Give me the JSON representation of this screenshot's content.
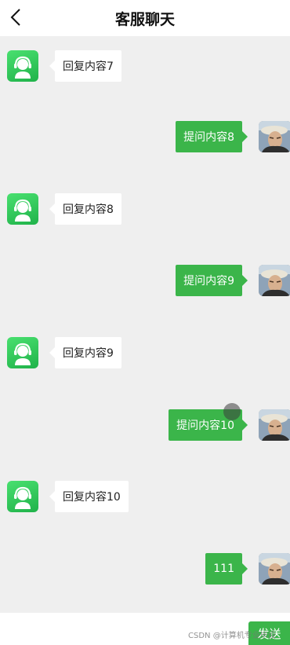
{
  "header": {
    "title": "客服聊天",
    "back_icon": "chevron-left-icon"
  },
  "messages": [
    {
      "role": "service",
      "text": "回复内容7"
    },
    {
      "role": "user",
      "text": "提问内容8"
    },
    {
      "role": "service",
      "text": "回复内容8"
    },
    {
      "role": "user",
      "text": "提问内容9"
    },
    {
      "role": "service",
      "text": "回复内容9"
    },
    {
      "role": "user",
      "text": "提问内容10"
    },
    {
      "role": "service",
      "text": "回复内容10"
    },
    {
      "role": "user",
      "text": "111"
    }
  ],
  "input": {
    "value": "",
    "placeholder": ""
  },
  "send_label": "发送",
  "watermark": "CSDN @计算机专业毕设",
  "colors": {
    "accent": "#3bb54a",
    "service_avatar": "#2fc257",
    "background": "#efefef"
  }
}
